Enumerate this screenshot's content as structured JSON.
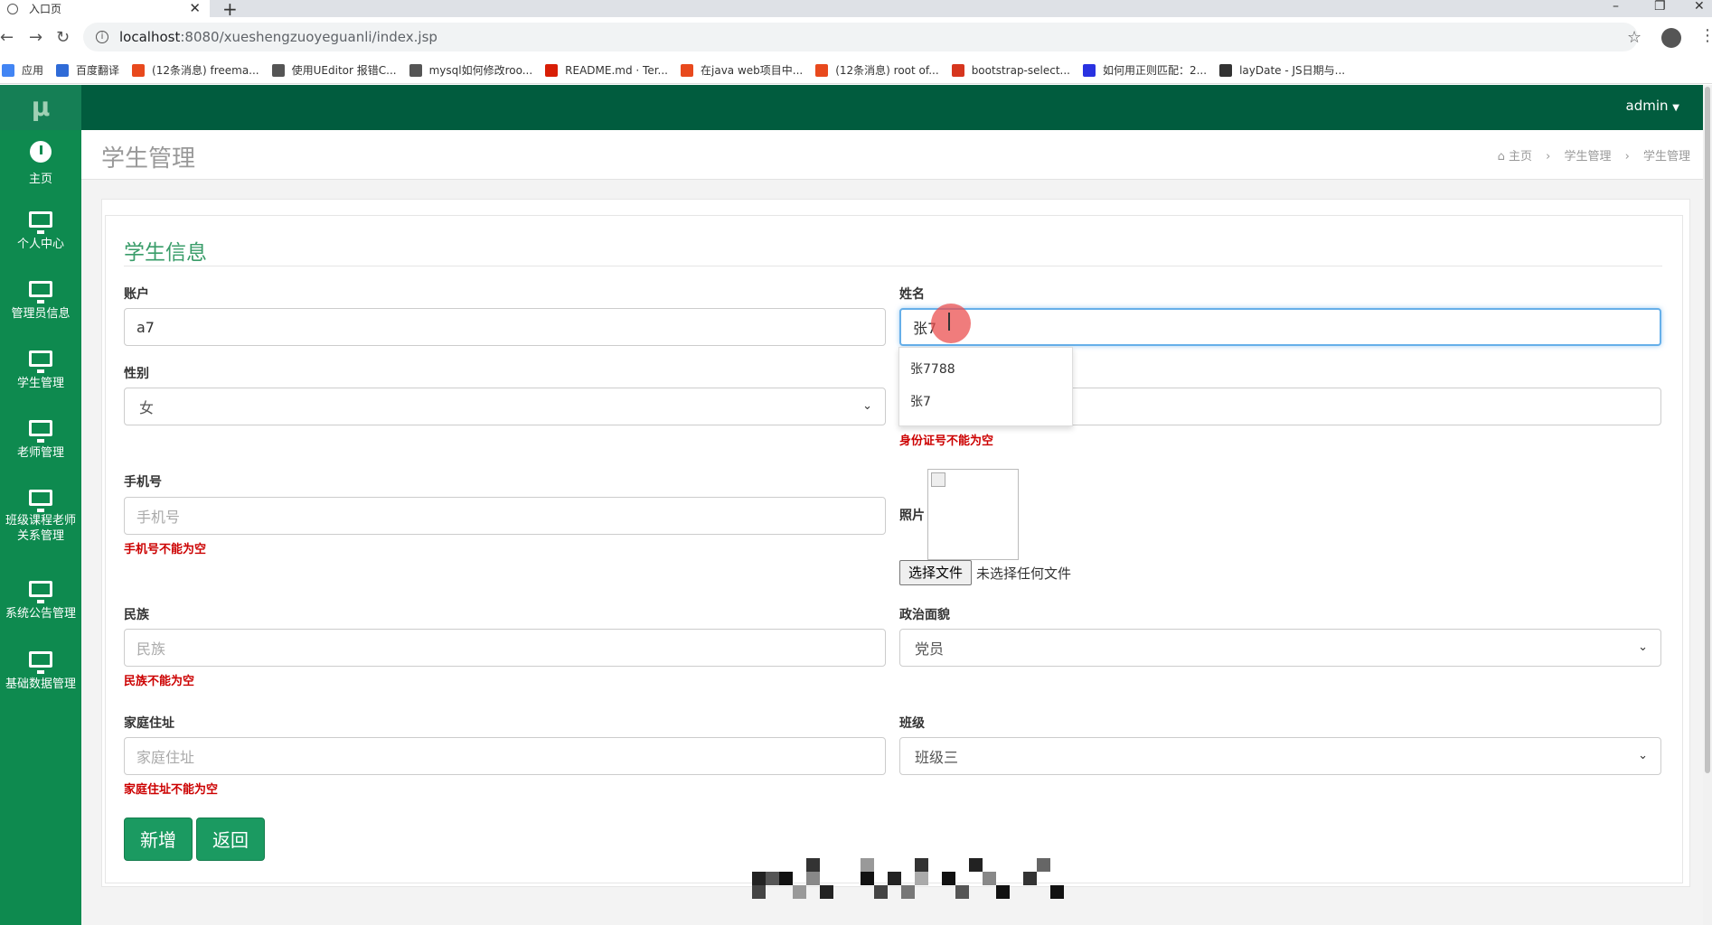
{
  "browser": {
    "tab_title": "入口页",
    "url_host": "localhost",
    "url_path": ":8080/xueshengzuoyeguanli/index.jsp",
    "bookmarks": [
      {
        "label": "应用",
        "color": "#4285f4",
        "icon": "apps-icon"
      },
      {
        "label": "百度翻译",
        "color": "#2f6bd7",
        "icon": "baidu-translate-icon"
      },
      {
        "label": "(12条消息) freema...",
        "color": "#e8491d",
        "icon": "csdn-icon"
      },
      {
        "label": "使用UEditor 报错C...",
        "color": "#555555",
        "icon": "weibo-icon"
      },
      {
        "label": "mysql如何修改roo...",
        "color": "#555555",
        "icon": "weibo-icon"
      },
      {
        "label": "README.md · Ter...",
        "color": "#d81e06",
        "icon": "gitee-icon"
      },
      {
        "label": "在java web项目中...",
        "color": "#e8491d",
        "icon": "csdn-icon"
      },
      {
        "label": "(12条消息) root of...",
        "color": "#e8491d",
        "icon": "csdn-icon"
      },
      {
        "label": "bootstrap-select...",
        "color": "#d6361e",
        "icon": "jianshu-icon"
      },
      {
        "label": "如何用正则匹配：2...",
        "color": "#2932e1",
        "icon": "baidu-paw-icon"
      },
      {
        "label": "layDate - JS日期与...",
        "color": "#333333",
        "icon": "layui-icon"
      }
    ]
  },
  "app": {
    "logo": "μ",
    "user": "admin",
    "accent": "#015c3e",
    "sidebar": [
      {
        "label": "主页",
        "icon": "dashboard-icon"
      },
      {
        "label": "个人中心",
        "icon": "monitor-icon"
      },
      {
        "label": "管理员信息",
        "icon": "monitor-icon"
      },
      {
        "label": "学生管理",
        "icon": "monitor-icon"
      },
      {
        "label": "老师管理",
        "icon": "monitor-icon"
      },
      {
        "label": "班级课程老师关系管理",
        "icon": "monitor-icon"
      },
      {
        "label": "系统公告管理",
        "icon": "monitor-icon"
      },
      {
        "label": "基础数据管理",
        "icon": "monitor-icon"
      }
    ],
    "page_title": "学生管理",
    "breadcrumb": [
      "主页",
      "学生管理",
      "学生管理"
    ]
  },
  "form": {
    "title": "学生信息",
    "account": {
      "label": "账户",
      "value": "a7"
    },
    "name": {
      "label": "姓名",
      "value": "张7"
    },
    "gender": {
      "label": "性别",
      "value": "女"
    },
    "id_number": {
      "error": "身份证号不能为空"
    },
    "phone": {
      "label": "手机号",
      "placeholder": "手机号",
      "error": "手机号不能为空"
    },
    "photo": {
      "label": "照片",
      "button": "选择文件",
      "status": "未选择任何文件"
    },
    "ethnicity": {
      "label": "民族",
      "placeholder": "民族",
      "error": "民族不能为空"
    },
    "politics": {
      "label": "政治面貌",
      "value": "党员"
    },
    "address": {
      "label": "家庭住址",
      "placeholder": "家庭住址",
      "error": "家庭住址不能为空"
    },
    "class": {
      "label": "班级",
      "value": "班级三"
    },
    "autocomplete": [
      "张7788",
      "张7"
    ],
    "add_button": "新增",
    "back_button": "返回"
  }
}
